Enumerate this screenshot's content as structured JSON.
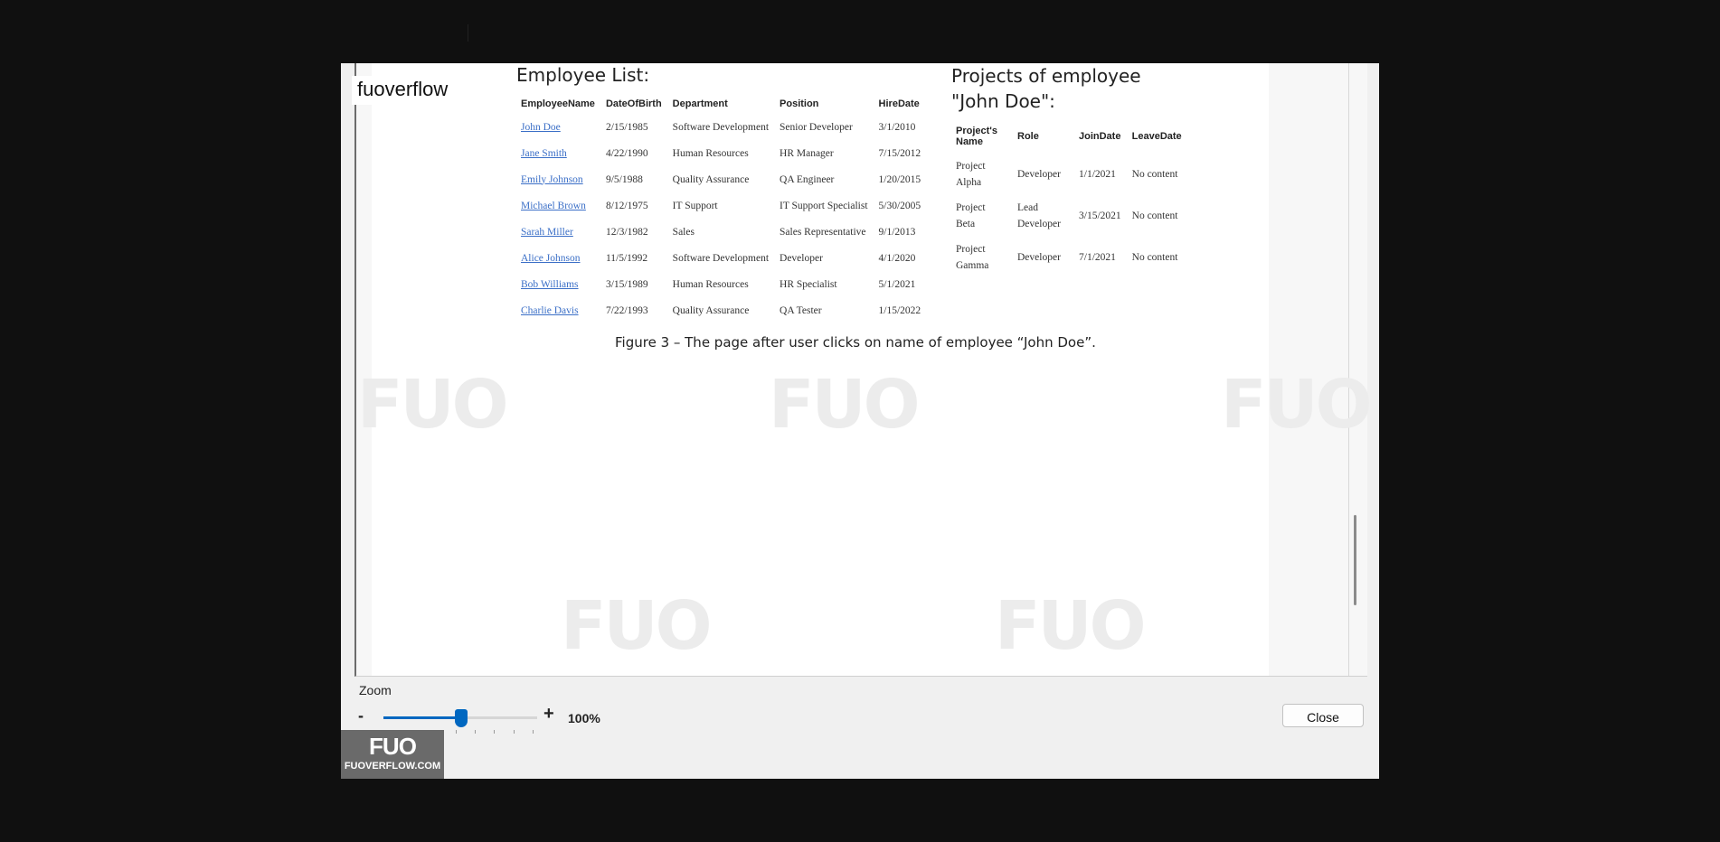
{
  "search": {
    "value": "fuoverflow"
  },
  "document": {
    "employee_title": "Employee List:",
    "employee_columns": [
      "EmployeeName",
      "DateOfBirth",
      "Department",
      "Position",
      "HireDate"
    ],
    "employees": [
      [
        "John Doe",
        "2/15/1985",
        "Software Development",
        "Senior Developer",
        "3/1/2010"
      ],
      [
        "Jane Smith",
        "4/22/1990",
        "Human Resources",
        "HR Manager",
        "7/15/2012"
      ],
      [
        "Emily Johnson",
        "9/5/1988",
        "Quality Assurance",
        "QA Engineer",
        "1/20/2015"
      ],
      [
        "Michael Brown",
        "8/12/1975",
        "IT Support",
        "IT Support Specialist",
        "5/30/2005"
      ],
      [
        "Sarah Miller",
        "12/3/1982",
        "Sales",
        "Sales Representative",
        "9/1/2013"
      ],
      [
        "Alice Johnson",
        "11/5/1992",
        "Software Development",
        "Developer",
        "4/1/2020"
      ],
      [
        "Bob Williams",
        "3/15/1989",
        "Human Resources",
        "HR Specialist",
        "5/1/2021"
      ],
      [
        "Charlie Davis",
        "7/22/1993",
        "Quality Assurance",
        "QA Tester",
        "1/15/2022"
      ]
    ],
    "projects_title_line1": "Projects of employee",
    "projects_title_line2": "\"John Doe\":",
    "project_columns": [
      "Project's Name",
      "Role",
      "JoinDate",
      "LeaveDate"
    ],
    "projects": [
      [
        "Project Alpha",
        "Developer",
        "1/1/2021",
        "No content"
      ],
      [
        "Project Beta",
        "Lead Developer",
        "3/15/2021",
        "No content"
      ],
      [
        "Project Gamma",
        "Developer",
        "7/1/2021",
        "No content"
      ]
    ],
    "caption": "Figure 3 – The page after user clicks on name of employee “John Doe”."
  },
  "zoom": {
    "label": "Zoom",
    "minus": "-",
    "plus": "+",
    "value_text": "100%",
    "level_fraction": 0.47
  },
  "close_label": "Close",
  "logo": {
    "mark": "FUO",
    "text": "FUOVERFLOW.COM"
  },
  "watermark": "FUO",
  "colors": {
    "link": "#3b6fc7",
    "accent": "#0067c0",
    "background": "#101010"
  }
}
